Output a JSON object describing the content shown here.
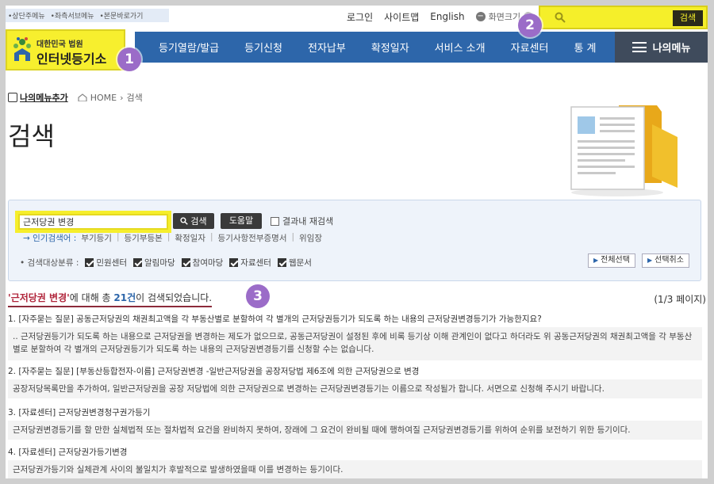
{
  "skipnav": [
    "•상단주메뉴",
    "•좌측서브메뉴",
    "•본문바로가기"
  ],
  "util": {
    "login": "로그인",
    "sitemap": "사이트맵",
    "english": "English",
    "zoom_label": "화면크기",
    "zoom_minus": "−",
    "zoom_plus": "+"
  },
  "top_search": {
    "button": "검색"
  },
  "logo": {
    "line1": "대한민국 법원",
    "line2": "인터넷등기소"
  },
  "gnb": [
    "등기열람/발급",
    "등기신청",
    "전자납부",
    "확정일자",
    "서비스 소개",
    "자료센터",
    "통  계"
  ],
  "mymenu": "나의메뉴",
  "badges": [
    "1",
    "2",
    "3"
  ],
  "breadcrumb": {
    "add": "나의메뉴추가",
    "home": "HOME",
    "sep": "›",
    "current": "검색"
  },
  "page_title": "검색",
  "searchbox": {
    "query": "근저당권 변경",
    "search_btn": "검색",
    "help_btn": "도움말",
    "research": "결과내 재검색",
    "popular_lead": "→ 인기검색어 :",
    "popular": [
      "부기등기",
      "등기부등본",
      "확정일자",
      "등기사항전부증명서",
      "위임장"
    ],
    "category_label": "• 검색대상분류 :",
    "categories": [
      "민원센터",
      "알림마당",
      "참여마당",
      "자료센터",
      "웹문서"
    ],
    "select_all": "전체선택",
    "deselect": "선택취소"
  },
  "summary": {
    "q_open": "'",
    "keyword": "근저당권 변경",
    "q_close": "'",
    "mid": "에 대해 총 ",
    "count": "21건",
    "tail": "이 검색되었습니다."
  },
  "pageinfo": "(1/3 페이지)",
  "results": [
    {
      "title": "1. [자주묻는 질문] 공동근저당권의 채권최고액을 각 부동산별로 분할하여 각 별개의 근저당권등기가 되도록 하는 내용의 근저당권변경등기가 가능한지요?",
      "body": ".. 근저당권등기가 되도록 하는 내용으로 근저당권을 변경하는 제도가 없으므로, 공동근저당권이 설정된 후에 비록 등기상 이해 관계인이 없다고 하더라도 위 공동근저당권의 채권최고액을 각 부동산별로 분할하여 각 별개의 근저당권등기가 되도록 하는 내용의 근저당권변경등기를 신청할 수는 없습니다."
    },
    {
      "title": "2. [자주묻는 질문] [부동산등합전자-이름] 근저당권변경 -일반근저당권을 공장저당법 제6조에 의한 근저당권으로 변경",
      "body": "공장저당목록만을 추가하여, 일반근저당권을 공장 저당법에 의한 근저당권으로 변경하는 근저당권변경등기는 이름으로 작성될가 합니다. 서면으로 신청해 주시기 바랍니다."
    },
    {
      "title": "3. [자료센터] 근저당권변경청구권가등기",
      "body": "근저당권변경등기를 할 만한 실체법적 또는 절차법적 요건을 완비하지 못하여, 장래에 그 요건이 완비될 때에 행하여질 근저당권변경등기를 위하여 순위를 보전하기 위한 등기이다."
    },
    {
      "title": "4. [자료센터] 근저당권가등기변경",
      "body": "근저당권가등기와 실체관계 사이의 불일치가 후발적으로 발생하였을때 이를 변경하는 등기이다."
    }
  ]
}
